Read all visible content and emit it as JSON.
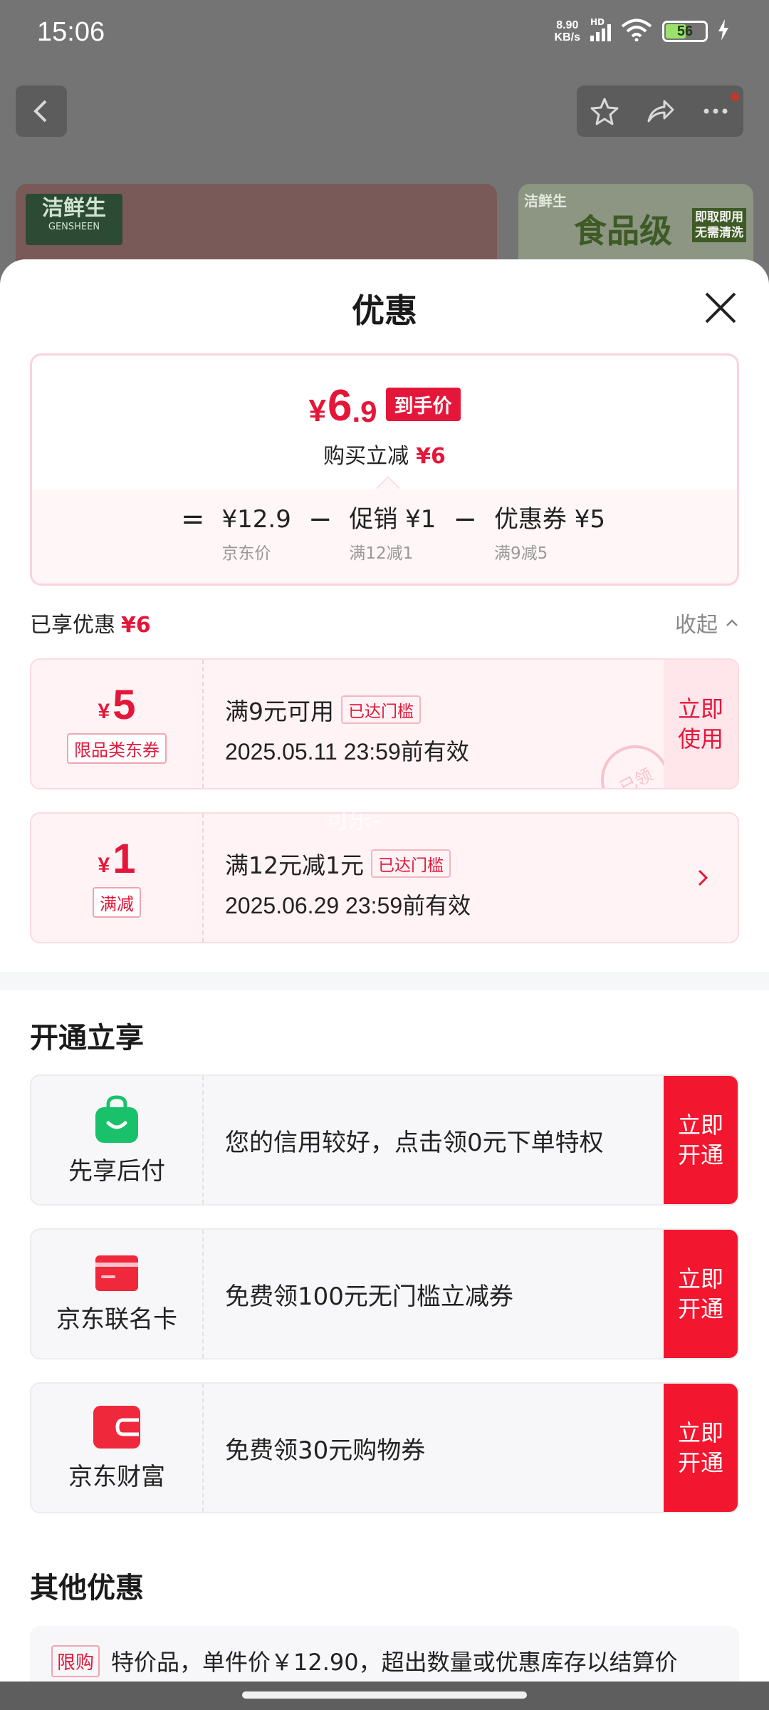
{
  "status_bar": {
    "time": "15:06",
    "net_speed_value": "8.90",
    "net_speed_unit": "KB/s",
    "signal_label": "HD",
    "battery_level": 56,
    "battery_text": "56"
  },
  "background": {
    "left_brand": "洁鲜生",
    "left_brand_en": "GENSHEEN",
    "right_brand": "洁鲜生",
    "right_headline": "食品级",
    "right_sub1": "即取即用",
    "right_sub2": "无需清洗"
  },
  "sheet": {
    "title": "优惠"
  },
  "price": {
    "currency": "¥",
    "integer": "6",
    "decimal": ".9",
    "badge": "到手价",
    "save_text": "购买立减",
    "save_amount": "¥6",
    "eq": "=",
    "minus": "−",
    "base_main": "¥12.9",
    "base_sub": "京东价",
    "promo_main": "促销 ¥1",
    "promo_sub": "满12减1",
    "coupon_main": "优惠券 ¥5",
    "coupon_sub": "满9减5"
  },
  "enjoyed": {
    "label": "已享优惠",
    "amount": "¥6",
    "collapse_label": "收起"
  },
  "coupons": [
    {
      "currency": "¥",
      "amount": "5",
      "tag": "限品类东券",
      "title": "满9元可用",
      "status": "已达门槛",
      "valid": "2025.05.11 23:59前有效",
      "action": "立即\n使用",
      "stamp": "已领"
    },
    {
      "currency": "¥",
      "amount": "1",
      "tag": "满减",
      "title": "满12元减1元",
      "status": "已达门槛",
      "valid": "2025.06.29 23:59前有效"
    }
  ],
  "watermark": "可乐-",
  "open_section": {
    "title": "开通立享",
    "items": [
      {
        "name": "先享后付",
        "text": "您的信用较好，点击领0元下单特权",
        "action": "立即\n开通",
        "icon": "bag-icon",
        "color": "#19c16b"
      },
      {
        "name": "京东联名卡",
        "text": "免费领100元无门槛立减券",
        "action": "立即\n开通",
        "icon": "card-icon",
        "color": "#f0283c"
      },
      {
        "name": "京东财富",
        "text": "免费领30元购物券",
        "action": "立即\n开通",
        "icon": "wallet-icon",
        "color": "#f0283c"
      }
    ]
  },
  "other_section": {
    "title": "其他优惠",
    "tag": "限购",
    "text": "特价品，单件价￥12.90，超出数量或优惠库存以结算价"
  }
}
